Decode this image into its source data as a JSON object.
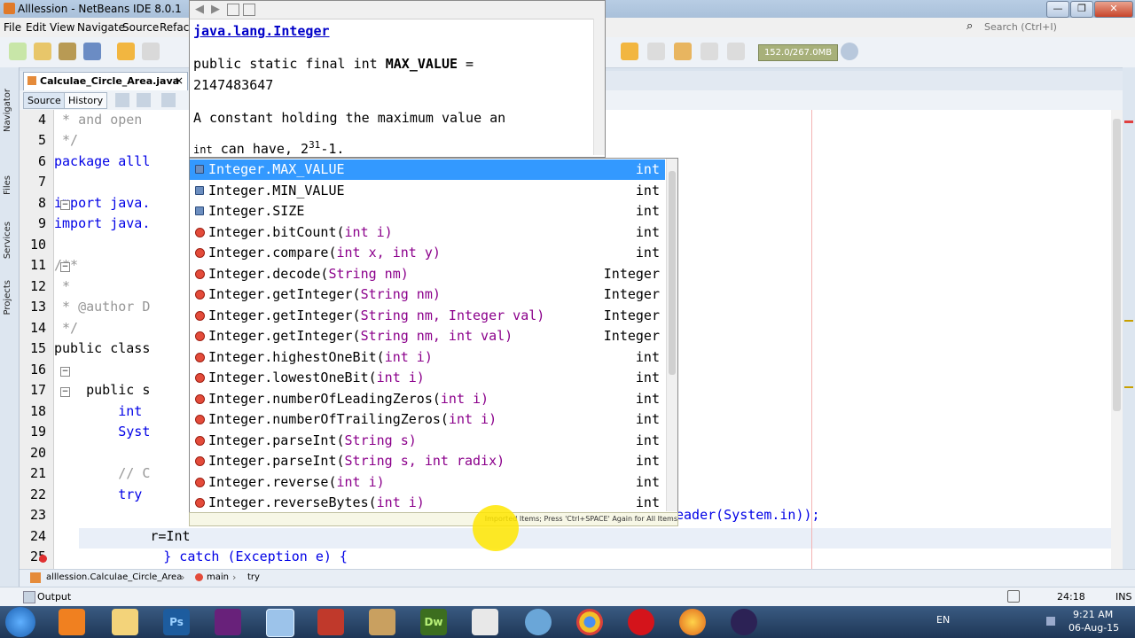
{
  "window": {
    "title": "Alllession - NetBeans IDE 8.0.1",
    "controls": [
      "—",
      "❐",
      "✕"
    ]
  },
  "menu": [
    "File",
    "Edit",
    "View",
    "Navigate",
    "Source",
    "Refact"
  ],
  "search": {
    "placeholder": "Search (Ctrl+I)"
  },
  "memory": "152.0/267.0MB",
  "left_panels": [
    "Navigator",
    "Files",
    "Services",
    "Projects"
  ],
  "tab": {
    "label": "Calculae_Circle_Area.java",
    "close": "×"
  },
  "editor_tabs": {
    "source": "Source",
    "history": "History"
  },
  "code": {
    "lines": [
      {
        "n": "",
        "text": "  * and open"
      },
      {
        "n": "4",
        "text": " * and open"
      },
      {
        "n": "5",
        "text": " */"
      },
      {
        "n": "6",
        "text": "package alll"
      },
      {
        "n": "7",
        "text": ""
      },
      {
        "n": "8",
        "text": "import java."
      },
      {
        "n": "9",
        "text": "import java."
      },
      {
        "n": "10",
        "text": ""
      },
      {
        "n": "11",
        "text": "/**"
      },
      {
        "n": "12",
        "text": " *"
      },
      {
        "n": "13",
        "text": " * @author D"
      },
      {
        "n": "14",
        "text": " */"
      },
      {
        "n": "15",
        "text": "public class"
      },
      {
        "n": "16",
        "text": ""
      },
      {
        "n": "17",
        "text": "    public s"
      },
      {
        "n": "18",
        "text": "        int"
      },
      {
        "n": "19",
        "text": "        Syst"
      },
      {
        "n": "20",
        "text": ""
      },
      {
        "n": "21",
        "text": "        // C"
      },
      {
        "n": "22",
        "text": "        try"
      },
      {
        "n": "23",
        "text": "eader(System.in));"
      },
      {
        "n": "24",
        "text": "            r=Int"
      },
      {
        "n": "25",
        "text": "        } catch (Exception e) {"
      }
    ]
  },
  "javadoc": {
    "class_link": "java.lang.Integer",
    "signature_prefix": "public static final int ",
    "signature_name": "MAX_VALUE",
    "signature_suffix": " =",
    "value": "2147483647",
    "desc1": "A constant holding the maximum value an",
    "desc2_prefix": "int",
    "desc2_mid": " can have, 2",
    "desc2_sup": "31",
    "desc2_suffix": "-1."
  },
  "completion": {
    "items": [
      {
        "name": "Integer.MAX_VALUE",
        "params": "",
        "ret": "int",
        "kind": "field",
        "selected": true
      },
      {
        "name": "Integer.MIN_VALUE",
        "params": "",
        "ret": "int",
        "kind": "field"
      },
      {
        "name": "Integer.SIZE",
        "params": "",
        "ret": "int",
        "kind": "field"
      },
      {
        "name": "Integer.bitCount(",
        "params": "int i)",
        "ret": "int",
        "kind": "method"
      },
      {
        "name": "Integer.compare(",
        "params": "int x, int y)",
        "ret": "int",
        "kind": "method"
      },
      {
        "name": "Integer.decode(",
        "params": "String nm)",
        "ret": "Integer",
        "kind": "method"
      },
      {
        "name": "Integer.getInteger(",
        "params": "String nm)",
        "ret": "Integer",
        "kind": "method"
      },
      {
        "name": "Integer.getInteger(",
        "params": "String nm, Integer val)",
        "ret": "Integer",
        "kind": "method"
      },
      {
        "name": "Integer.getInteger(",
        "params": "String nm, int val)",
        "ret": "Integer",
        "kind": "method"
      },
      {
        "name": "Integer.highestOneBit(",
        "params": "int i)",
        "ret": "int",
        "kind": "method"
      },
      {
        "name": "Integer.lowestOneBit(",
        "params": "int i)",
        "ret": "int",
        "kind": "method"
      },
      {
        "name": "Integer.numberOfLeadingZeros(",
        "params": "int i)",
        "ret": "int",
        "kind": "method"
      },
      {
        "name": "Integer.numberOfTrailingZeros(",
        "params": "int i)",
        "ret": "int",
        "kind": "method"
      },
      {
        "name": "Integer.parseInt(",
        "params": "String s)",
        "ret": "int",
        "kind": "method"
      },
      {
        "name": "Integer.parseInt(",
        "params": "String s, int radix)",
        "ret": "int",
        "kind": "method"
      },
      {
        "name": "Integer.reverse(",
        "params": "int i)",
        "ret": "int",
        "kind": "method"
      },
      {
        "name": "Integer.reverseBytes(",
        "params": "int i)",
        "ret": "int",
        "kind": "method"
      }
    ],
    "hint": "Imported Items; Press 'Ctrl+SPACE' Again for All Items"
  },
  "breadcrumb": [
    "alllession.Calculae_Circle_Area",
    "main",
    "try"
  ],
  "status": {
    "output": "Output",
    "position": "24:18",
    "mode": "INS"
  },
  "tray": {
    "lang": "EN",
    "time": "9:21 AM",
    "date": "06-Aug-15"
  },
  "taskbar_apps": [
    "start-icon",
    "media-player-icon",
    "explorer-icon",
    "photoshop-icon",
    "visual-studio-icon",
    "virtualbox-icon",
    "filezilla-icon",
    "tools-icon",
    "dreamweaver-icon",
    "window-icon",
    "network-icon",
    "chrome-icon",
    "opera-icon",
    "firefox-icon",
    "eclipse-icon"
  ]
}
